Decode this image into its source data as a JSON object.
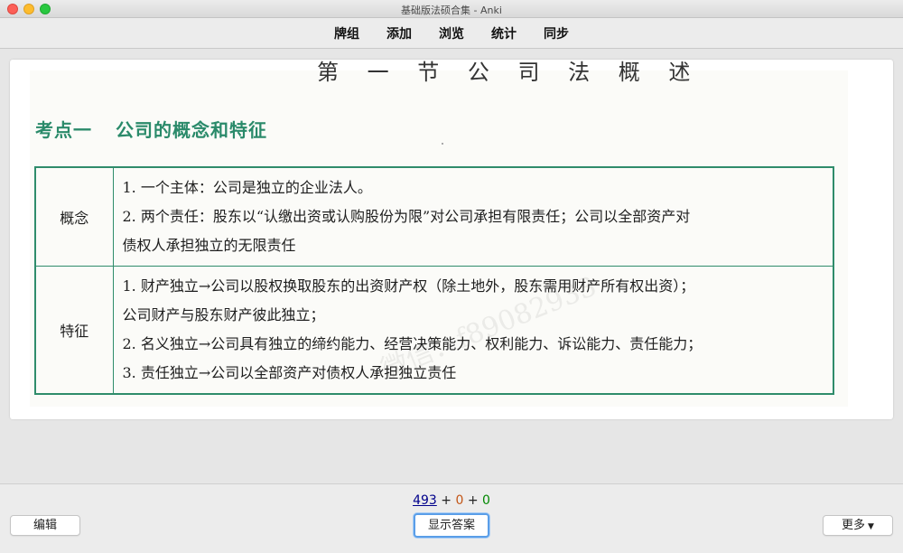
{
  "window": {
    "title": "基础版法硕合集 - Anki"
  },
  "toolbar": {
    "items": [
      "牌组",
      "添加",
      "浏览",
      "统计",
      "同步"
    ]
  },
  "card": {
    "chapter_title_partial": "第 一 节 公 司 法 概 述",
    "section_label": "考点一",
    "section_title": "公司的概念和特征",
    "watermark": "微信：f89082933",
    "rows": [
      {
        "header": "概念",
        "lines": [
          "1. 一个主体：公司是独立的企业法人。",
          "2. 两个责任：股东以“认缴出资或认购股份为限”对公司承担有限责任；公司以全部资产对",
          "债权人承担独立的无限责任"
        ]
      },
      {
        "header": "特征",
        "lines": [
          "1. 财产独立→公司以股权换取股东的出资财产权（除土地外，股东需用财产所有权出资）；",
          "公司财产与股东财产彼此独立；",
          "2. 名义独立→公司具有独立的缔约能力、经营决策能力、权利能力、诉讼能力、责任能力；",
          "3. 责任独立→公司以全部资产对债权人承担独立责任"
        ]
      }
    ]
  },
  "bottom": {
    "count_new": "493",
    "plus1": "+",
    "count_learn": "0",
    "plus2": "+",
    "count_review": "0",
    "edit_label": "编辑",
    "show_answer_label": "显示答案",
    "more_label": "更多"
  },
  "colors": {
    "accent_green": "#2f8c6b",
    "new_count": "#00008b",
    "learn_count": "#c35617",
    "review_count": "#008800"
  }
}
